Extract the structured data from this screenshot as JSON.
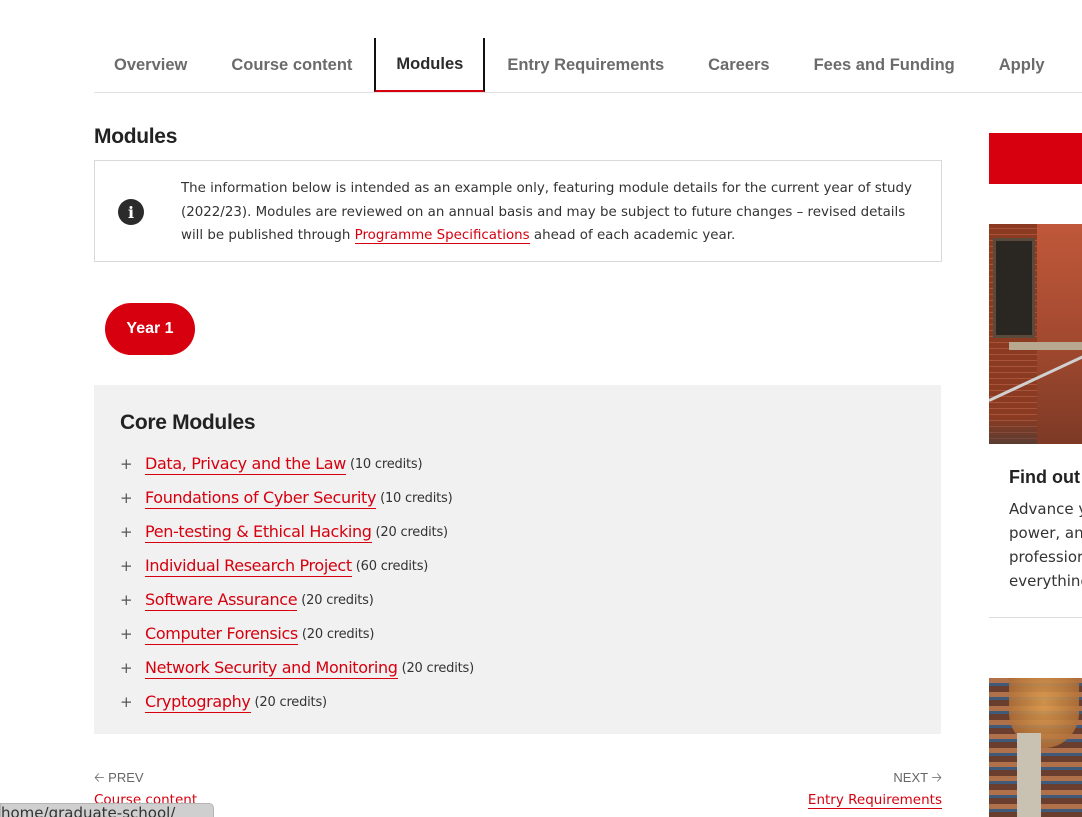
{
  "tabs": [
    {
      "label": "Overview",
      "active": false
    },
    {
      "label": "Course content",
      "active": false
    },
    {
      "label": "Modules",
      "active": true
    },
    {
      "label": "Entry Requirements",
      "active": false
    },
    {
      "label": "Careers",
      "active": false
    },
    {
      "label": "Fees and Funding",
      "active": false
    },
    {
      "label": "Apply",
      "active": false
    }
  ],
  "section_title": "Modules",
  "info": {
    "icon": "info-circle-icon",
    "text_before": "The information below is intended as an example only, featuring module details for the current year of study (2022/23). Modules are reviewed on an annual basis and may be subject to future changes – revised details will be published through ",
    "link_label": "Programme Specifications",
    "text_after": " ahead of each academic year."
  },
  "year_pill": "Year 1",
  "core_modules": {
    "title": "Core Modules",
    "items": [
      {
        "name": "Data, Privacy and the Law",
        "credits": "(10 credits)"
      },
      {
        "name": "Foundations of Cyber Security",
        "credits": "(10 credits)"
      },
      {
        "name": "Pen-testing & Ethical Hacking",
        "credits": "(20 credits)"
      },
      {
        "name": "Individual Research Project",
        "credits": "(60 credits)"
      },
      {
        "name": "Software Assurance",
        "credits": "(20 credits)"
      },
      {
        "name": "Computer Forensics",
        "credits": "(20 credits)"
      },
      {
        "name": "Network Security and Monitoring",
        "credits": "(20 credits)"
      },
      {
        "name": "Cryptography",
        "credits": "(20 credits)"
      }
    ],
    "expand_symbol": "+"
  },
  "pager": {
    "prev_label": "PREV",
    "prev_link": "Course content",
    "next_label": "NEXT",
    "next_link": "Entry Requirements"
  },
  "status_bar": "home/graduate-school/",
  "sidebar": {
    "card_title": "Find out",
    "card_text": [
      "Advance y",
      "power, an",
      "professior",
      "everything"
    ]
  },
  "colors": {
    "brand_red": "#d6000f",
    "panel_bg": "#f1f1f1",
    "tab_text": "#6b6b6b"
  }
}
